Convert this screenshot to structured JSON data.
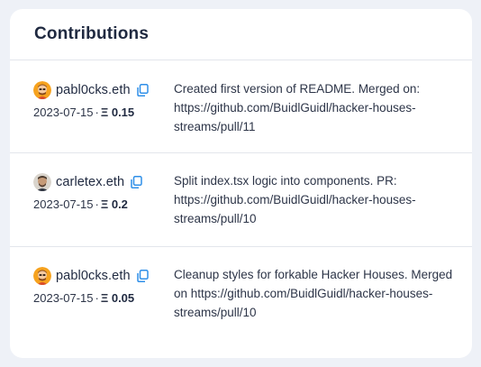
{
  "header": {
    "title": "Contributions"
  },
  "contributions": [
    {
      "username": "pabl0cks.eth",
      "avatar": "orange-avatar",
      "date": "2023-07-15",
      "separator": "·",
      "eth_symbol": "Ξ",
      "amount": "0.15",
      "description": "Created first version of README. Merged on: https://github.com/BuidlGuidl/hacker-houses-streams/pull/11"
    },
    {
      "username": "carletex.eth",
      "avatar": "photo-avatar",
      "date": "2023-07-15",
      "separator": "·",
      "eth_symbol": "Ξ",
      "amount": "0.2",
      "description": "Split index.tsx logic into components. PR: https://github.com/BuidlGuidl/hacker-houses-streams/pull/10"
    },
    {
      "username": "pabl0cks.eth",
      "avatar": "orange-avatar",
      "date": "2023-07-15",
      "separator": "·",
      "eth_symbol": "Ξ",
      "amount": "0.05",
      "description": "Cleanup styles for forkable Hacker Houses. Merged on https://github.com/BuidlGuidl/hacker-houses-streams/pull/10"
    }
  ],
  "icons": {
    "copy": "copy-icon",
    "accent": "#2f8fe8"
  }
}
